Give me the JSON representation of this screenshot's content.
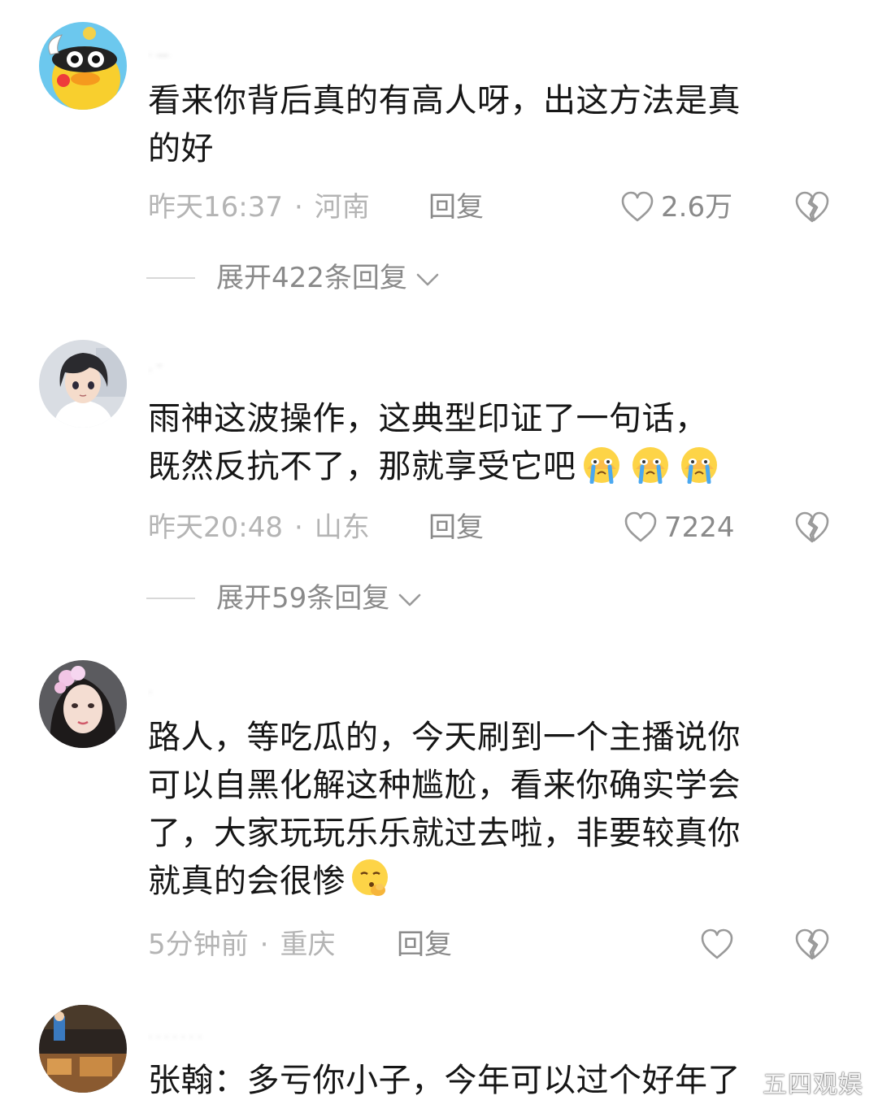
{
  "comments": [
    {
      "username": "·  —",
      "text_lines": [
        "看来你背后真的有高人呀，出这方法是真",
        "的好"
      ],
      "time": "昨天16:37",
      "location": "河南",
      "reply_label": "回复",
      "likes": "2.6万",
      "expand_label": "展开422条回复"
    },
    {
      "username": "·  ˜",
      "text_lines": [
        "雨神这波操作，这典型印证了一句话，",
        "既然反抗不了，那就享受它吧"
      ],
      "time": "昨天20:48",
      "location": "山东",
      "reply_label": "回复",
      "likes": "7224",
      "expand_label": "展开59条回复"
    },
    {
      "username": "·",
      "text_lines": [
        "路人，等吃瓜的，今天刷到一个主播说你",
        "可以自黑化解这种尴尬，看来你确实学会",
        "了，大家玩玩乐乐就过去啦，非要较真你",
        "就真的会很惨"
      ],
      "time": "5分钟前",
      "location": "重庆",
      "reply_label": "回复",
      "likes": ""
    },
    {
      "username": "· · · · · · ·",
      "text_lines": [
        "张翰：多亏你小子，今年可以过个好年了"
      ]
    }
  ],
  "icons": {
    "like": "heart-outline-icon",
    "dislike": "broken-heart-icon",
    "expand": "chevron-down-icon"
  },
  "watermark": "五四观娱",
  "colors": {
    "text": "#161616",
    "meta": "#b4b4b4",
    "action": "#8a8a8a"
  }
}
